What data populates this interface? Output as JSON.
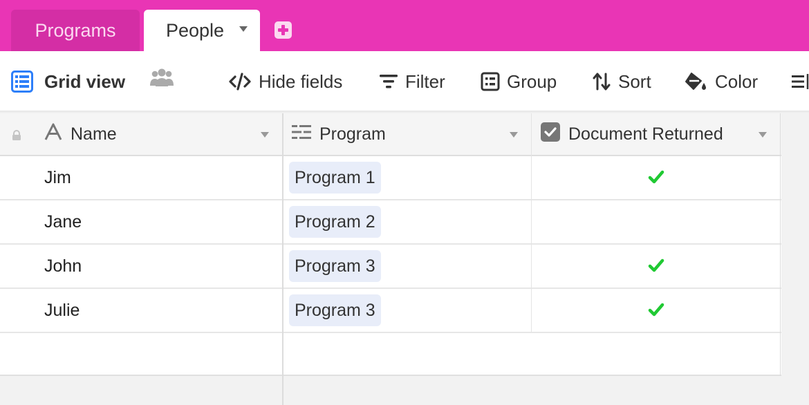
{
  "tabs": {
    "programs_label": "Programs",
    "people_label": "People"
  },
  "toolbar": {
    "view_label": "Grid view",
    "hide_fields_label": "Hide fields",
    "filter_label": "Filter",
    "group_label": "Group",
    "sort_label": "Sort",
    "color_label": "Color"
  },
  "columns": {
    "name": "Name",
    "program": "Program",
    "document_returned": "Document Returned"
  },
  "rows": [
    {
      "name": "Jim",
      "program": "Program 1",
      "document_returned": true
    },
    {
      "name": "Jane",
      "program": "Program 2",
      "document_returned": false
    },
    {
      "name": "John",
      "program": "Program 3",
      "document_returned": true
    },
    {
      "name": "Julie",
      "program": "Program 3",
      "document_returned": true
    }
  ],
  "colors": {
    "brand": "#e935b5",
    "check": "#20c933",
    "pill": "#e8edf9",
    "view_icon": "#2d7ff9"
  },
  "icons": {
    "view": "grid-view-icon",
    "collaborators": "people-icon",
    "hide_fields": "eye-slash-icon",
    "filter": "filter-icon",
    "group": "group-icon",
    "sort": "sort-icon",
    "color": "paint-bucket-icon",
    "row_height": "row-height-icon",
    "lock": "lock-icon",
    "name_field": "text-field-icon",
    "program_field": "linked-record-icon",
    "checkbox_field": "checkbox-field-icon",
    "checked": "checkmark-icon"
  }
}
